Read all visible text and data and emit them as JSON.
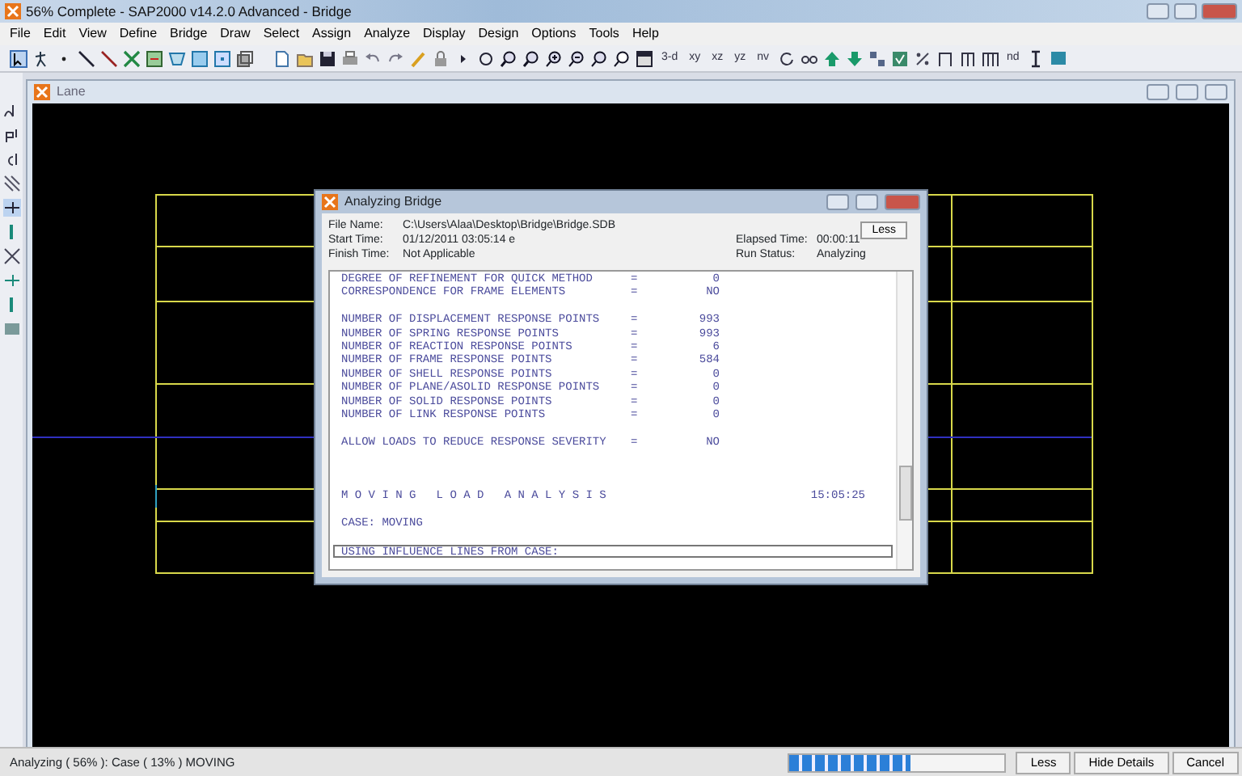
{
  "window": {
    "title": "56% Complete - SAP2000 v14.2.0 Advanced  - Bridge"
  },
  "menu": [
    "File",
    "Edit",
    "View",
    "Define",
    "Bridge",
    "Draw",
    "Select",
    "Assign",
    "Analyze",
    "Display",
    "Design",
    "Options",
    "Tools",
    "Help"
  ],
  "toolbar": {
    "view_buttons": [
      "3-d",
      "xy",
      "xz",
      "yz",
      "nv"
    ],
    "extra_button": "nd"
  },
  "child_window": {
    "title": "Lane"
  },
  "dialog": {
    "title": "Analyzing Bridge",
    "less_button": "Less",
    "fields": [
      {
        "label": "File Name:",
        "value": "C:\\Users\\Alaa\\Desktop\\Bridge\\Bridge.SDB"
      },
      {
        "label": "Start Time:",
        "value": "01/12/2011 03:05:14 е",
        "label2": "Elapsed Time:",
        "value2": "00:00:11"
      },
      {
        "label": "Finish Time:",
        "value": "Not Applicable",
        "label2": "Run Status:",
        "value2": "Analyzing"
      }
    ],
    "log": [
      {
        "kind": "pair",
        "label": "DEGREE OF REFINEMENT FOR QUICK METHOD",
        "sign": "=",
        "value": "0"
      },
      {
        "kind": "pair",
        "label": "CORRESPONDENCE FOR FRAME ELEMENTS",
        "sign": "=",
        "value": "NO"
      },
      {
        "kind": "blank"
      },
      {
        "kind": "pair",
        "label": "NUMBER OF DISPLACEMENT RESPONSE POINTS",
        "sign": "=",
        "value": "993"
      },
      {
        "kind": "pair",
        "label": "NUMBER OF SPRING RESPONSE POINTS",
        "sign": "=",
        "value": "993"
      },
      {
        "kind": "pair",
        "label": "NUMBER OF REACTION RESPONSE POINTS",
        "sign": "=",
        "value": "6"
      },
      {
        "kind": "pair",
        "label": "NUMBER OF FRAME RESPONSE POINTS",
        "sign": "=",
        "value": "584"
      },
      {
        "kind": "pair",
        "label": "NUMBER OF SHELL RESPONSE POINTS",
        "sign": "=",
        "value": "0"
      },
      {
        "kind": "pair",
        "label": "NUMBER OF PLANE/ASOLID RESPONSE POINTS",
        "sign": "=",
        "value": "0"
      },
      {
        "kind": "pair",
        "label": "NUMBER OF SOLID RESPONSE POINTS",
        "sign": "=",
        "value": "0"
      },
      {
        "kind": "pair",
        "label": "NUMBER OF LINK RESPONSE POINTS",
        "sign": "=",
        "value": "0"
      },
      {
        "kind": "blank"
      },
      {
        "kind": "pair",
        "label": "ALLOW LOADS TO REDUCE RESPONSE SEVERITY",
        "sign": "=",
        "value": "NO"
      },
      {
        "kind": "blank"
      },
      {
        "kind": "blank"
      },
      {
        "kind": "blank"
      },
      {
        "kind": "heading",
        "label": "M O V I N G   L O A D   A N A L Y S I S",
        "value": "15:05:25"
      },
      {
        "kind": "blank"
      },
      {
        "kind": "text",
        "label": "CASE: MOVING"
      },
      {
        "kind": "blank"
      },
      {
        "kind": "current",
        "label": "USING INFLUENCE LINES FROM CASE:"
      }
    ]
  },
  "status_bar": {
    "text": "Analyzing ( 56% ):  Case ( 13% ) MOVING",
    "progress": {
      "level": 0.56
    },
    "buttons": [
      "Less",
      "Hide Details",
      "Cancel"
    ]
  }
}
